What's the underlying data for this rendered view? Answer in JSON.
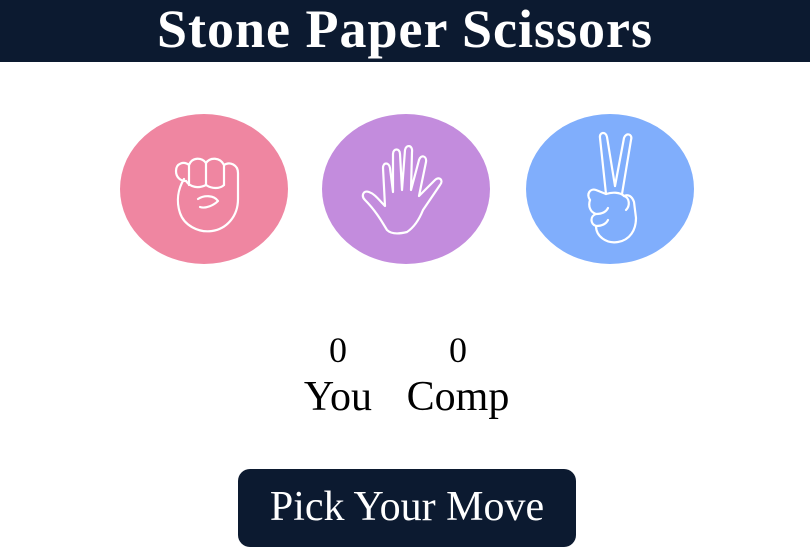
{
  "header": {
    "title": "Stone Paper Scissors",
    "background": "#0c1a30"
  },
  "choices": [
    {
      "id": "stone",
      "icon": "fist-icon",
      "color": "#ef86a1"
    },
    {
      "id": "paper",
      "icon": "open-hand-icon",
      "color": "#c38cdd"
    },
    {
      "id": "scissors",
      "icon": "peace-hand-icon",
      "color": "#80aefc"
    }
  ],
  "score": {
    "user": {
      "value": "0",
      "label": "You"
    },
    "comp": {
      "value": "0",
      "label": "Comp"
    }
  },
  "message": {
    "text": "Pick Your Move",
    "background": "#0c1a30"
  }
}
